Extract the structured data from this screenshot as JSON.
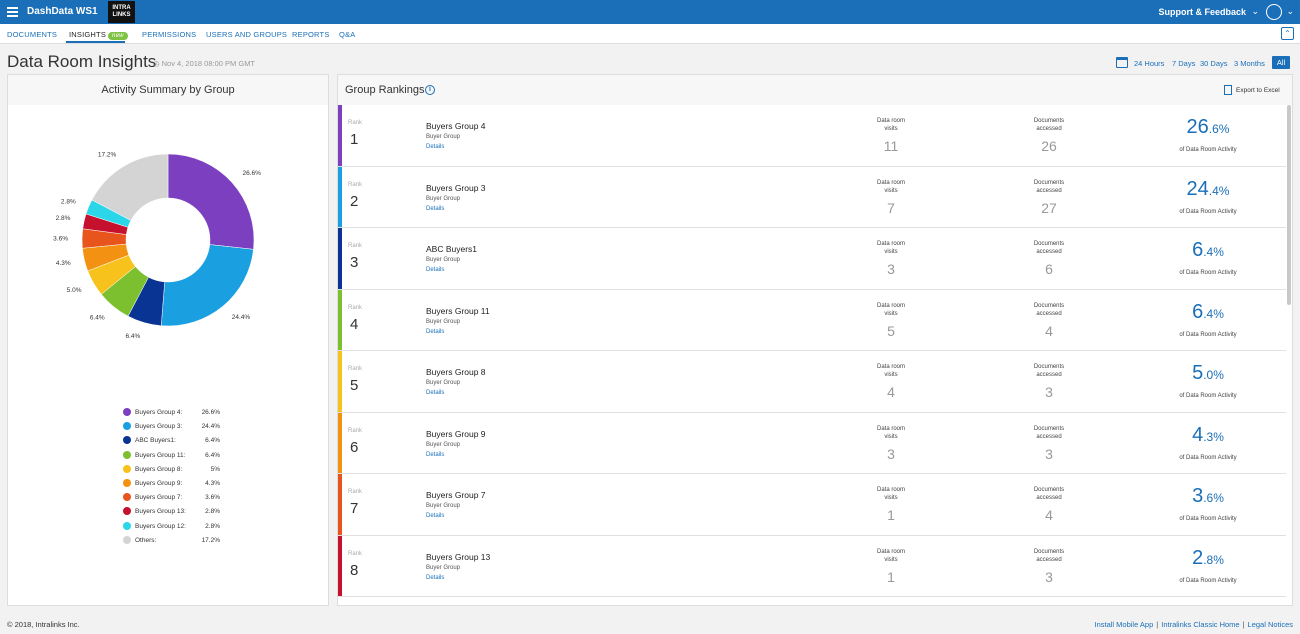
{
  "header": {
    "app_title": "DashData WS1",
    "logo_text_1": "INTRA",
    "logo_text_2": "LINKS",
    "support_label": "Support & Feedback"
  },
  "nav": {
    "tabs": [
      {
        "label": "DOCUMENTS"
      },
      {
        "label": "INSIGHTS",
        "badge": "new"
      },
      {
        "label": "PERMISSIONS"
      },
      {
        "label": "USERS AND GROUPS"
      },
      {
        "label": "REPORTS"
      },
      {
        "label": "Q&A"
      }
    ]
  },
  "page": {
    "title": "Data Room Insights",
    "date": "Nov 4, 2018 08:00 PM GMT",
    "ranges": [
      "24 Hours",
      "7 Days",
      "30 Days",
      "3 Months",
      "All"
    ],
    "selected_range": "All"
  },
  "summary": {
    "title": "Activity Summary by Group",
    "chart_data": {
      "type": "pie",
      "categories": [
        "Buyers Group 4",
        "Buyers Group 3",
        "ABC Buyers1",
        "Buyers Group 11",
        "Buyers Group 8",
        "Buyers Group 9",
        "Buyers Group 7",
        "Buyers Group 13",
        "Buyers Group 12",
        "Others"
      ],
      "values": [
        26.6,
        24.4,
        6.4,
        6.4,
        5.0,
        4.3,
        3.6,
        2.8,
        2.8,
        17.2
      ],
      "slice_labels": [
        "26.6%",
        "24.4%",
        "6.4%",
        "6.4%",
        "5.0%",
        "4.3%",
        "3.6%",
        "2.8%",
        "2.8%",
        "17.2%"
      ],
      "colors": [
        "#7b3fbf",
        "#1a9fe0",
        "#0a3494",
        "#7cbf2f",
        "#f7c21b",
        "#f39212",
        "#e8551c",
        "#c5102e",
        "#2ad6e8",
        "#d4d4d4"
      ]
    },
    "legend": [
      {
        "name": "Buyers Group 4:",
        "value": "26.6%"
      },
      {
        "name": "Buyers Group 3:",
        "value": "24.4%"
      },
      {
        "name": "ABC Buyers1:",
        "value": "6.4%"
      },
      {
        "name": "Buyers Group 11:",
        "value": "6.4%"
      },
      {
        "name": "Buyers Group 8:",
        "value": "5%"
      },
      {
        "name": "Buyers Group 9:",
        "value": "4.3%"
      },
      {
        "name": "Buyers Group 7:",
        "value": "3.6%"
      },
      {
        "name": "Buyers Group 13:",
        "value": "2.8%"
      },
      {
        "name": "Buyers Group 12:",
        "value": "2.8%"
      },
      {
        "name": "Others:",
        "value": "17.2%"
      }
    ]
  },
  "rankings": {
    "title": "Group Rankings",
    "export_label": "Export to Excel",
    "rank_label": "Rank",
    "visits_label_1": "Data room",
    "visits_label_2": "visits",
    "docs_label_1": "Documents",
    "docs_label_2": "accessed",
    "activity_label": "of Data Room Activity",
    "details_label": "Details",
    "rows": [
      {
        "rank": "1",
        "name": "Buyers Group 4",
        "type": "Buyer Group",
        "visits": "11",
        "docs": "26",
        "pct_int": "26",
        "pct_dec": ".6%",
        "color": "#7b3fbf"
      },
      {
        "rank": "2",
        "name": "Buyers Group 3",
        "type": "Buyer Group",
        "visits": "7",
        "docs": "27",
        "pct_int": "24",
        "pct_dec": ".4%",
        "color": "#1a9fe0"
      },
      {
        "rank": "3",
        "name": "ABC Buyers1",
        "type": "Buyer Group",
        "visits": "3",
        "docs": "6",
        "pct_int": "6",
        "pct_dec": ".4%",
        "color": "#0a3494"
      },
      {
        "rank": "4",
        "name": "Buyers Group 11",
        "type": "Buyer Group",
        "visits": "5",
        "docs": "4",
        "pct_int": "6",
        "pct_dec": ".4%",
        "color": "#7cbf2f"
      },
      {
        "rank": "5",
        "name": "Buyers Group 8",
        "type": "Buyer Group",
        "visits": "4",
        "docs": "3",
        "pct_int": "5",
        "pct_dec": ".0%",
        "color": "#f7c21b"
      },
      {
        "rank": "6",
        "name": "Buyers Group 9",
        "type": "Buyer Group",
        "visits": "3",
        "docs": "3",
        "pct_int": "4",
        "pct_dec": ".3%",
        "color": "#f39212"
      },
      {
        "rank": "7",
        "name": "Buyers Group 7",
        "type": "Buyer Group",
        "visits": "1",
        "docs": "4",
        "pct_int": "3",
        "pct_dec": ".6%",
        "color": "#e8551c"
      },
      {
        "rank": "8",
        "name": "Buyers Group 13",
        "type": "Buyer Group",
        "visits": "1",
        "docs": "3",
        "pct_int": "2",
        "pct_dec": ".8%",
        "color": "#c5102e"
      }
    ]
  },
  "footer": {
    "copyright": "© 2018, Intralinks Inc.",
    "links": [
      "Install Mobile App",
      "Intralinks Classic Home",
      "Legal Notices"
    ]
  }
}
